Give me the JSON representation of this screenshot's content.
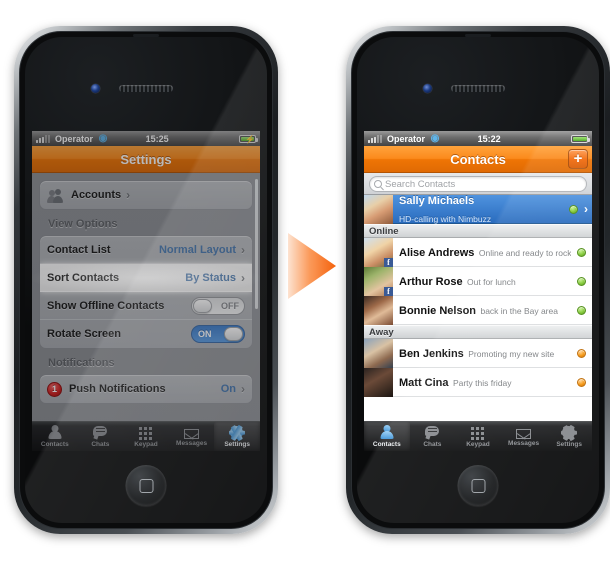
{
  "phones": {
    "left": {
      "statusbar": {
        "signal_icon": "signal-bars-icon",
        "carrier": "Operator",
        "wifi_icon": "wifi-icon",
        "time": "15:25",
        "battery_icon": "battery-charging-icon"
      },
      "navbar": {
        "title": "Settings"
      },
      "screen_name": "settings-screen",
      "groups": [
        {
          "title": "",
          "rows": [
            {
              "icon": "accounts-people-icon",
              "label": "Accounts",
              "value": "",
              "control": "chevron",
              "highlight": false
            }
          ]
        },
        {
          "title": "View Options",
          "rows": [
            {
              "icon": "",
              "label": "Contact List",
              "value": "Normal Layout",
              "control": "chevron",
              "highlight": false
            },
            {
              "icon": "",
              "label": "Sort Contacts",
              "value": "By Status",
              "control": "chevron",
              "highlight": true
            },
            {
              "icon": "",
              "label": "Show Offline Contacts",
              "value": "OFF",
              "control": "toggle-off",
              "highlight": false
            },
            {
              "icon": "",
              "label": "Rotate Screen",
              "value": "ON",
              "control": "toggle-on",
              "highlight": false
            }
          ]
        },
        {
          "title": "Notifications",
          "rows": [
            {
              "icon": "notification-badge-icon",
              "badge": "1",
              "label": "Push Notifications",
              "value": "On",
              "control": "chevron",
              "highlight": false
            }
          ]
        }
      ],
      "tabs": [
        {
          "label": "Contacts",
          "icon": "person-icon",
          "active": false
        },
        {
          "label": "Chats",
          "icon": "chat-bubble-icon",
          "active": false
        },
        {
          "label": "Keypad",
          "icon": "keypad-grid-icon",
          "active": false
        },
        {
          "label": "Messages",
          "icon": "envelope-icon",
          "active": false
        },
        {
          "label": "Settings",
          "icon": "gear-icon",
          "active": true
        }
      ]
    },
    "right": {
      "statusbar": {
        "signal_icon": "signal-bars-icon",
        "carrier": "Operator",
        "wifi_icon": "wifi-icon",
        "time": "15:22",
        "battery_icon": "battery-full-icon"
      },
      "navbar": {
        "title": "Contacts",
        "add_label": "+"
      },
      "screen_name": "contacts-screen",
      "search": {
        "placeholder": "Search Contacts",
        "value": "",
        "icon": "search-icon"
      },
      "list": [
        {
          "type": "contact",
          "name": "Sally Michaels",
          "status_text": "HD-calling with Nimbuzz",
          "presence": "online",
          "selected": true,
          "chevron": true,
          "badge": ""
        },
        {
          "type": "section",
          "name": "Online"
        },
        {
          "type": "contact",
          "name": "Alise Andrews",
          "status_text": "Online and ready to rock",
          "presence": "online",
          "selected": false,
          "chevron": false,
          "badge": "f"
        },
        {
          "type": "contact",
          "name": "Arthur Rose",
          "status_text": "Out for lunch",
          "presence": "online",
          "selected": false,
          "chevron": false,
          "badge": "f"
        },
        {
          "type": "contact",
          "name": "Bonnie Nelson",
          "status_text": "back in the Bay area",
          "presence": "online",
          "selected": false,
          "chevron": false,
          "badge": ""
        },
        {
          "type": "section",
          "name": "Away"
        },
        {
          "type": "contact",
          "name": "Ben Jenkins",
          "status_text": "Promoting my new site",
          "presence": "away",
          "selected": false,
          "chevron": false,
          "badge": ""
        },
        {
          "type": "contact",
          "name": "Matt Cina",
          "status_text": "Party this friday",
          "presence": "away",
          "selected": false,
          "chevron": false,
          "badge": ""
        }
      ],
      "tabs": [
        {
          "label": "Contacts",
          "icon": "person-icon",
          "active": true
        },
        {
          "label": "Chats",
          "icon": "chat-bubble-icon",
          "active": false
        },
        {
          "label": "Keypad",
          "icon": "keypad-grid-icon",
          "active": false
        },
        {
          "label": "Messages",
          "icon": "envelope-icon",
          "active": false
        },
        {
          "label": "Settings",
          "icon": "gear-icon",
          "active": false
        }
      ]
    }
  },
  "arrow": {
    "icon": "arrow-right-icon",
    "color_light": "#fbd6bd",
    "color_dark": "#f4651a"
  },
  "colors": {
    "accent_orange": "#f4790a",
    "selection_blue": "#3a7fd0",
    "value_blue": "#3a6ea8",
    "online_green": "#7dc72f",
    "away_orange": "#f59207",
    "badge_red": "#cf1d1d"
  }
}
